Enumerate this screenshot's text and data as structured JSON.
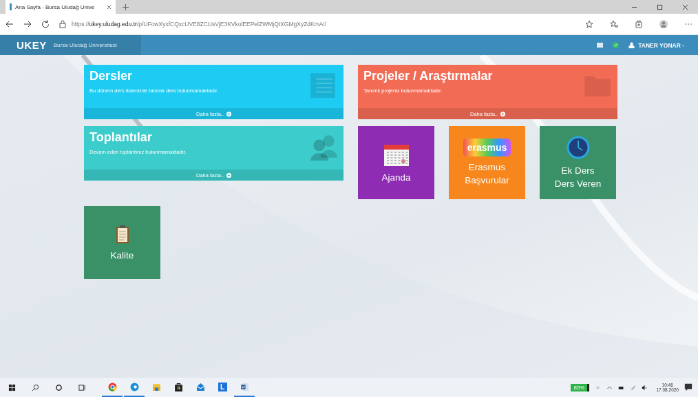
{
  "browser": {
    "tab_title": "Ana Sayfa - Bursa Uludağ Unive",
    "url": "https://**ukey.uludag.edu.tr**/p/UFowXyxfCQxcUVE8ZCUsVjE3KVkolEEPelZWMjQtXGMgXyZdKmA!/"
  },
  "header": {
    "logo": "UKEY",
    "subtitle": "Bursa Uludağ Üniversitesi",
    "user": "TANER YONAR -"
  },
  "cards": [
    {
      "title": "Dersler",
      "text": "Bu dönem ders listenizde tanımlı ders bulunmamaktadır.",
      "more": "Daha fazla..",
      "color": "#1ecbf2",
      "kind": "document"
    },
    {
      "title": "Projeler / Araştırmalar",
      "text": "Tanımlı projeniz bulunmamaktadır.",
      "more": "Daha fazla..",
      "color": "#f26b55",
      "kind": "folder"
    },
    {
      "title": "Toplantılar",
      "text": "Devam eden toplantınız bulunmamaktadır.",
      "more": "Daha fazla..",
      "color": "#3ccccb",
      "kind": "users"
    }
  ],
  "tiles": [
    {
      "label": "Ajanda",
      "color": "#8e2db4",
      "kind": "calendar"
    },
    {
      "label": "Erasmus Başvurular",
      "color": "#f7861c",
      "kind": "erasmus",
      "logo_text": "erasmus"
    },
    {
      "label": "Ek Ders Ders Veren",
      "color": "#3a9168",
      "kind": "clock"
    },
    {
      "label": "Kalite",
      "color": "#3a9168",
      "kind": "clipboard"
    }
  ],
  "taskbar": {
    "apps": [
      {
        "kind": "chrome",
        "running": true
      },
      {
        "kind": "edge",
        "running": true
      },
      {
        "kind": "files",
        "running": false
      },
      {
        "kind": "store",
        "running": false
      },
      {
        "kind": "mail",
        "running": false
      },
      {
        "kind": "l",
        "running": false,
        "letter": "L"
      },
      {
        "kind": "word",
        "running": true
      }
    ],
    "battery": "85%",
    "time": "10:46",
    "date": "17.08.2020"
  }
}
